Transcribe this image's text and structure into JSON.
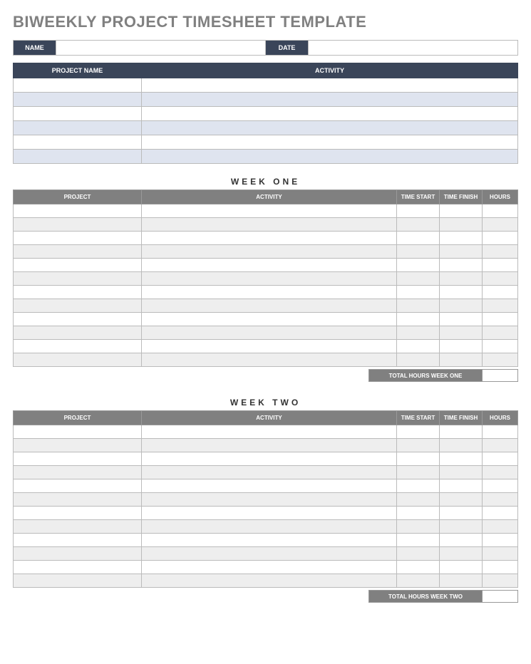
{
  "title": "BIWEEKLY PROJECT TIMESHEET TEMPLATE",
  "header": {
    "name_label": "NAME",
    "name_value": "",
    "date_label": "DATE",
    "date_value": ""
  },
  "project_section": {
    "headers": {
      "project": "PROJECT NAME",
      "activity": "ACTIVITY"
    },
    "rows": [
      {
        "project": "",
        "activity": "",
        "alt": false
      },
      {
        "project": "",
        "activity": "",
        "alt": true
      },
      {
        "project": "",
        "activity": "",
        "alt": false
      },
      {
        "project": "",
        "activity": "",
        "alt": true
      },
      {
        "project": "",
        "activity": "",
        "alt": false
      },
      {
        "project": "",
        "activity": "",
        "alt": true
      }
    ]
  },
  "weeks": [
    {
      "title": "WEEK ONE",
      "headers": {
        "project": "PROJECT",
        "activity": "ACTIVITY",
        "time_start": "TIME START",
        "time_finish": "TIME FINISH",
        "hours": "HOURS"
      },
      "rows": [
        {
          "alt": false
        },
        {
          "alt": true
        },
        {
          "alt": false
        },
        {
          "alt": true
        },
        {
          "alt": false
        },
        {
          "alt": true
        },
        {
          "alt": false
        },
        {
          "alt": true
        },
        {
          "alt": false
        },
        {
          "alt": true
        },
        {
          "alt": false
        },
        {
          "alt": true
        }
      ],
      "total_label": "TOTAL HOURS WEEK ONE",
      "total_value": ""
    },
    {
      "title": "WEEK TWO",
      "headers": {
        "project": "PROJECT",
        "activity": "ACTIVITY",
        "time_start": "TIME START",
        "time_finish": "TIME FINISH",
        "hours": "HOURS"
      },
      "rows": [
        {
          "alt": false
        },
        {
          "alt": true
        },
        {
          "alt": false
        },
        {
          "alt": true
        },
        {
          "alt": false
        },
        {
          "alt": true
        },
        {
          "alt": false
        },
        {
          "alt": true
        },
        {
          "alt": false
        },
        {
          "alt": true
        },
        {
          "alt": false
        },
        {
          "alt": true
        }
      ],
      "total_label": "TOTAL HOURS WEEK TWO",
      "total_value": ""
    }
  ]
}
